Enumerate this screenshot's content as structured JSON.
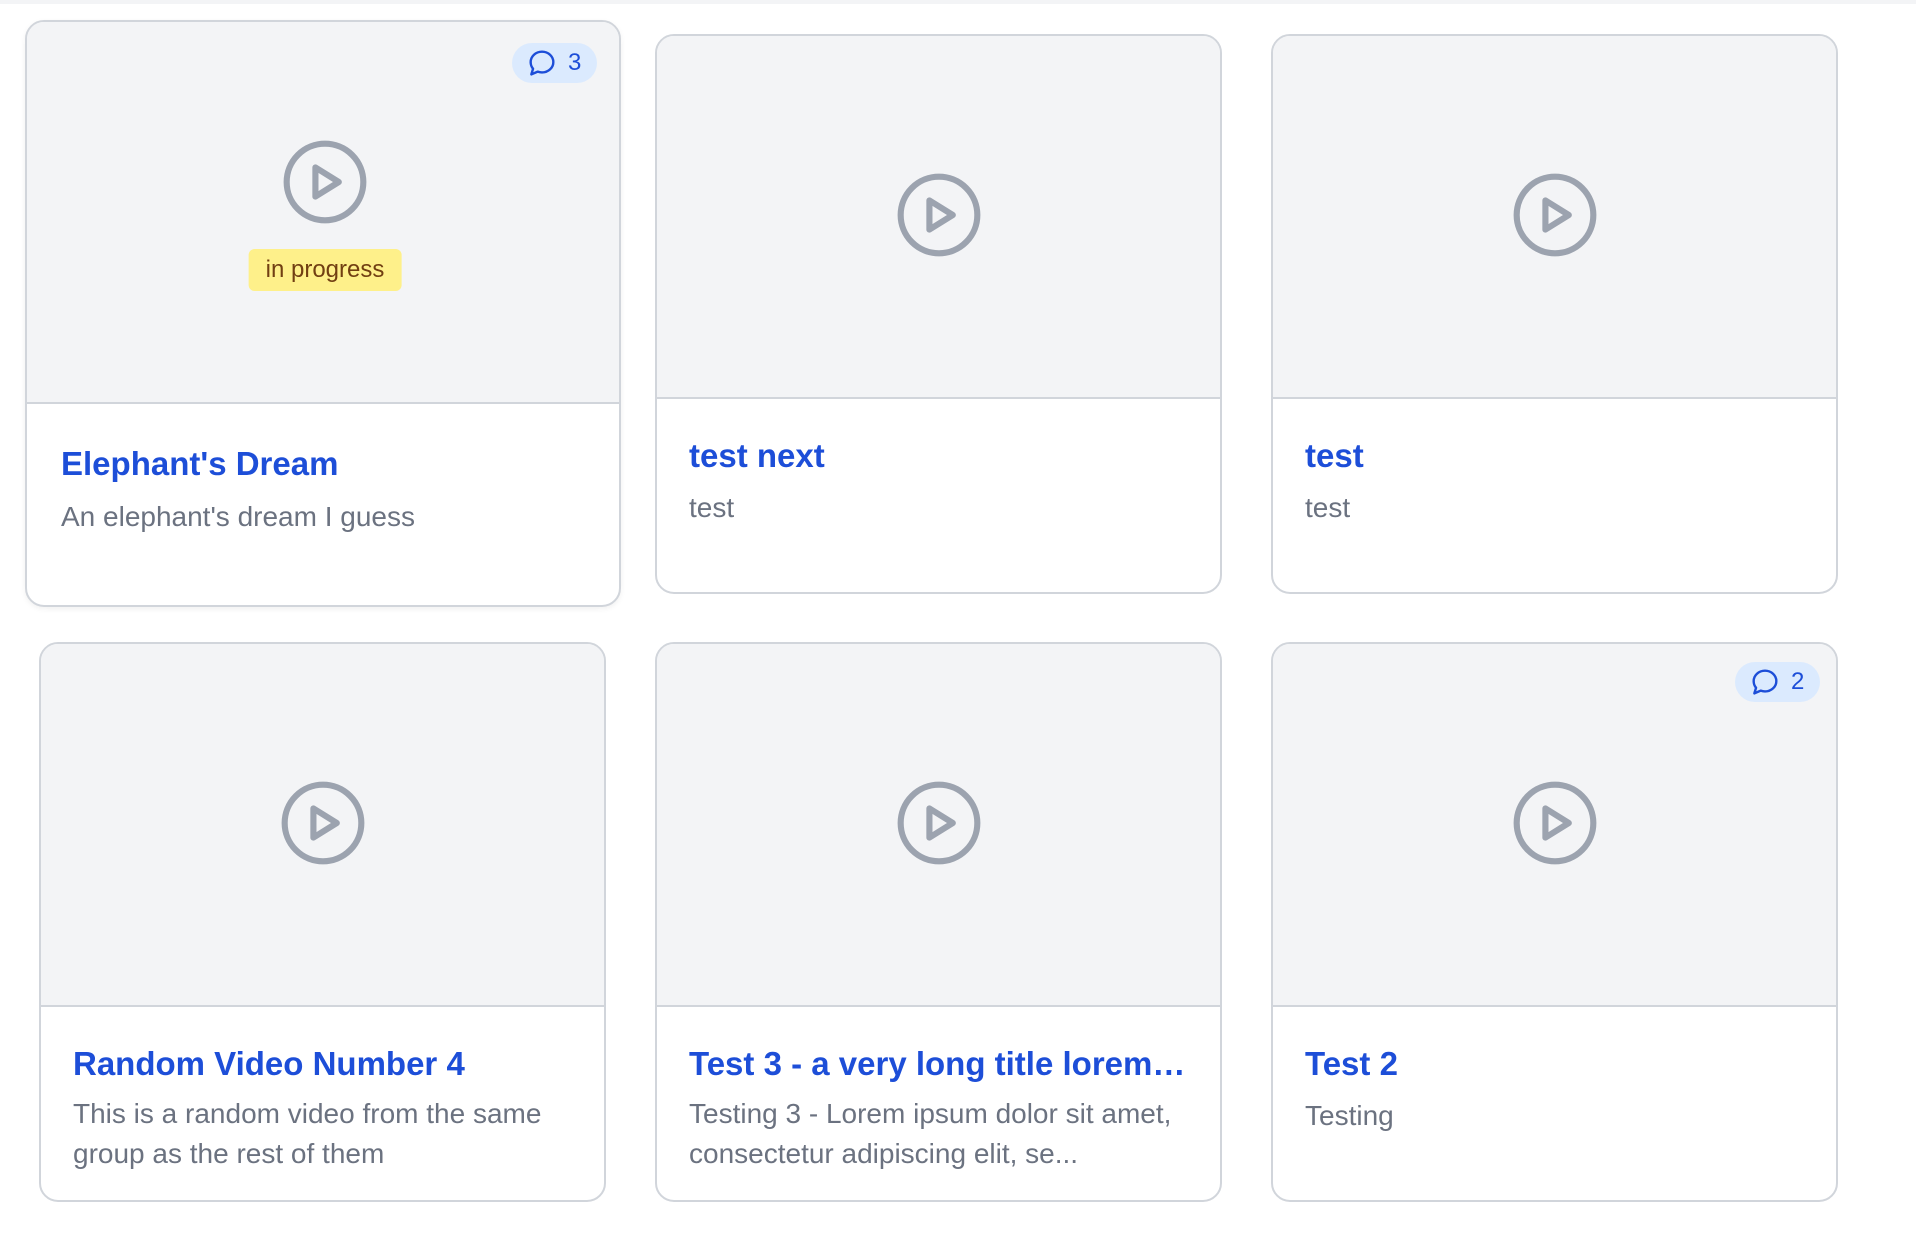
{
  "videos": [
    {
      "title": "Elephant's Dream",
      "description": "An elephant's dream I guess",
      "status": "in progress",
      "comments": "3"
    },
    {
      "title": "test next",
      "description": "test"
    },
    {
      "title": "test",
      "description": "test"
    },
    {
      "title": "Random Video Number 4",
      "description": "This is a random video from the same group as the rest of them"
    },
    {
      "title": "Test 3 - a very long title lorem ...",
      "description": "Testing 3 - Lorem ipsum dolor sit amet, consectetur adipiscing elit, se..."
    },
    {
      "title": "Test 2",
      "description": "Testing",
      "comments": "2"
    }
  ],
  "icons": {
    "play": "play-circle-icon",
    "comment": "chat-bubble-icon"
  },
  "colors": {
    "title": "#1d4ed8",
    "description": "#6b7280",
    "thumbnail_bg": "#f3f4f6",
    "status_badge_bg": "#fef08a",
    "comment_badge_bg": "#dbeafe",
    "icon_gray": "#9ca3af"
  }
}
